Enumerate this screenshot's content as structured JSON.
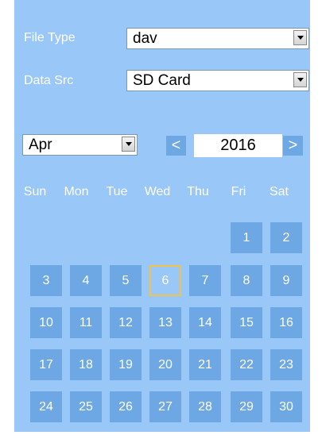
{
  "filters": {
    "file_type": {
      "label": "File Type",
      "value": "dav"
    },
    "data_src": {
      "label": "Data Src",
      "value": "SD Card"
    }
  },
  "month_select": {
    "value": "Apr"
  },
  "year_nav": {
    "prev_label": "<",
    "year": "2016",
    "next_label": ">"
  },
  "weekdays": [
    "Sun",
    "Mon",
    "Tue",
    "Wed",
    "Thu",
    "Fri",
    "Sat"
  ],
  "days": {
    "blanks": 5,
    "list": [
      "1",
      "2",
      "3",
      "4",
      "5",
      "6",
      "7",
      "8",
      "9",
      "10",
      "11",
      "12",
      "13",
      "14",
      "15",
      "16",
      "17",
      "18",
      "19",
      "20",
      "21",
      "22",
      "23",
      "24",
      "25",
      "26",
      "27",
      "28",
      "29",
      "30"
    ],
    "highlighted": "6"
  },
  "colors": {
    "panel_bg": "#99c7f7",
    "cell_bg": "#6ea8e4",
    "highlight_border": "#f0c14d"
  }
}
